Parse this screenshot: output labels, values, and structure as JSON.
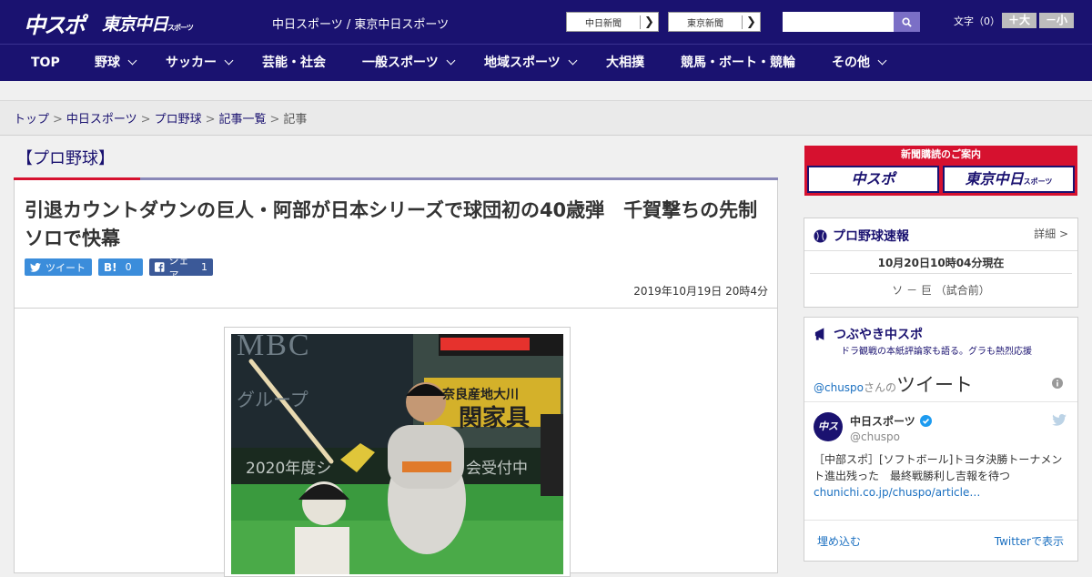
{
  "header": {
    "logo_main": "中スポ",
    "logo_tokyo": "東京中日",
    "logo_tokyo_small": "スポーツ",
    "site_name": "中日スポーツ / 東京中日スポーツ",
    "ext_links": [
      {
        "label": "中日新聞",
        "arrow": "❯"
      },
      {
        "label": "東京新聞",
        "arrow": "❯"
      }
    ],
    "search_placeholder": "",
    "font_size_label": "文字（0）",
    "font_larger": "＋大",
    "font_smaller": "－小"
  },
  "nav": {
    "items": [
      {
        "label": "TOP",
        "has_dropdown": false
      },
      {
        "label": "野球",
        "has_dropdown": true
      },
      {
        "label": "サッカー",
        "has_dropdown": true
      },
      {
        "label": "芸能・社会",
        "has_dropdown": false
      },
      {
        "label": "一般スポーツ",
        "has_dropdown": true
      },
      {
        "label": "地域スポーツ",
        "has_dropdown": true
      },
      {
        "label": "大相撲",
        "has_dropdown": false
      },
      {
        "label": "競馬・ボート・競輪",
        "has_dropdown": false
      },
      {
        "label": "その他",
        "has_dropdown": true
      }
    ]
  },
  "breadcrumb": {
    "items": [
      "トップ",
      "中日スポーツ",
      "プロ野球",
      "記事一覧"
    ],
    "separator": ">",
    "current": "記事"
  },
  "article": {
    "category": "【プロ野球】",
    "headline": "引退カウントダウンの巨人・阿部が日本シリーズで球団初の40歳弾　千賀撃ちの先制ソロで快幕",
    "share": {
      "tweet_label": "ツイート",
      "hatena_icon": "B!",
      "hatena_count": "0",
      "facebook_label": "シェア",
      "facebook_count": "1"
    },
    "date": "2019年10月19日 20時4分",
    "photo_texts": [
      "MBC",
      "グループ",
      "2020年度シ",
      "会受付中",
      "奈良産地大川",
      "関家具"
    ]
  },
  "sidebar": {
    "subscription": {
      "title": "新聞購読のご案内",
      "buttons": [
        "中スポ",
        "東京中日"
      ],
      "button_small": "スポーツ"
    },
    "baseball": {
      "title": "プロ野球速報",
      "detail_link": "詳細 >",
      "time": "10月20日10時04分現在",
      "game": "ソ － 巨 （試合前）"
    },
    "tweets": {
      "title": "つぶやき中スポ",
      "subtitle": "ドラ観戦の本紙評論家も語る。グラも熱烈応援",
      "handle_prefix": "@chuspo",
      "handle_suffix": "さんの",
      "tweets_word": "ツイート",
      "user_name": "中日スポーツ",
      "user_handle": "@chuspo",
      "tweet_text": "［中部スポ］[ソフトボール]トヨタ決勝トーナメント進出残った　最終戦勝利し吉報を待つ",
      "tweet_link": "chunichi.co.jp/chuspo/article…",
      "embed_link": "埋め込む",
      "view_link": "Twitterで表示"
    }
  },
  "colors": {
    "brand_navy": "#1a1270",
    "accent_red": "#d6112f",
    "share_blue": "#3b8ddb",
    "facebook_blue": "#3b5998"
  }
}
